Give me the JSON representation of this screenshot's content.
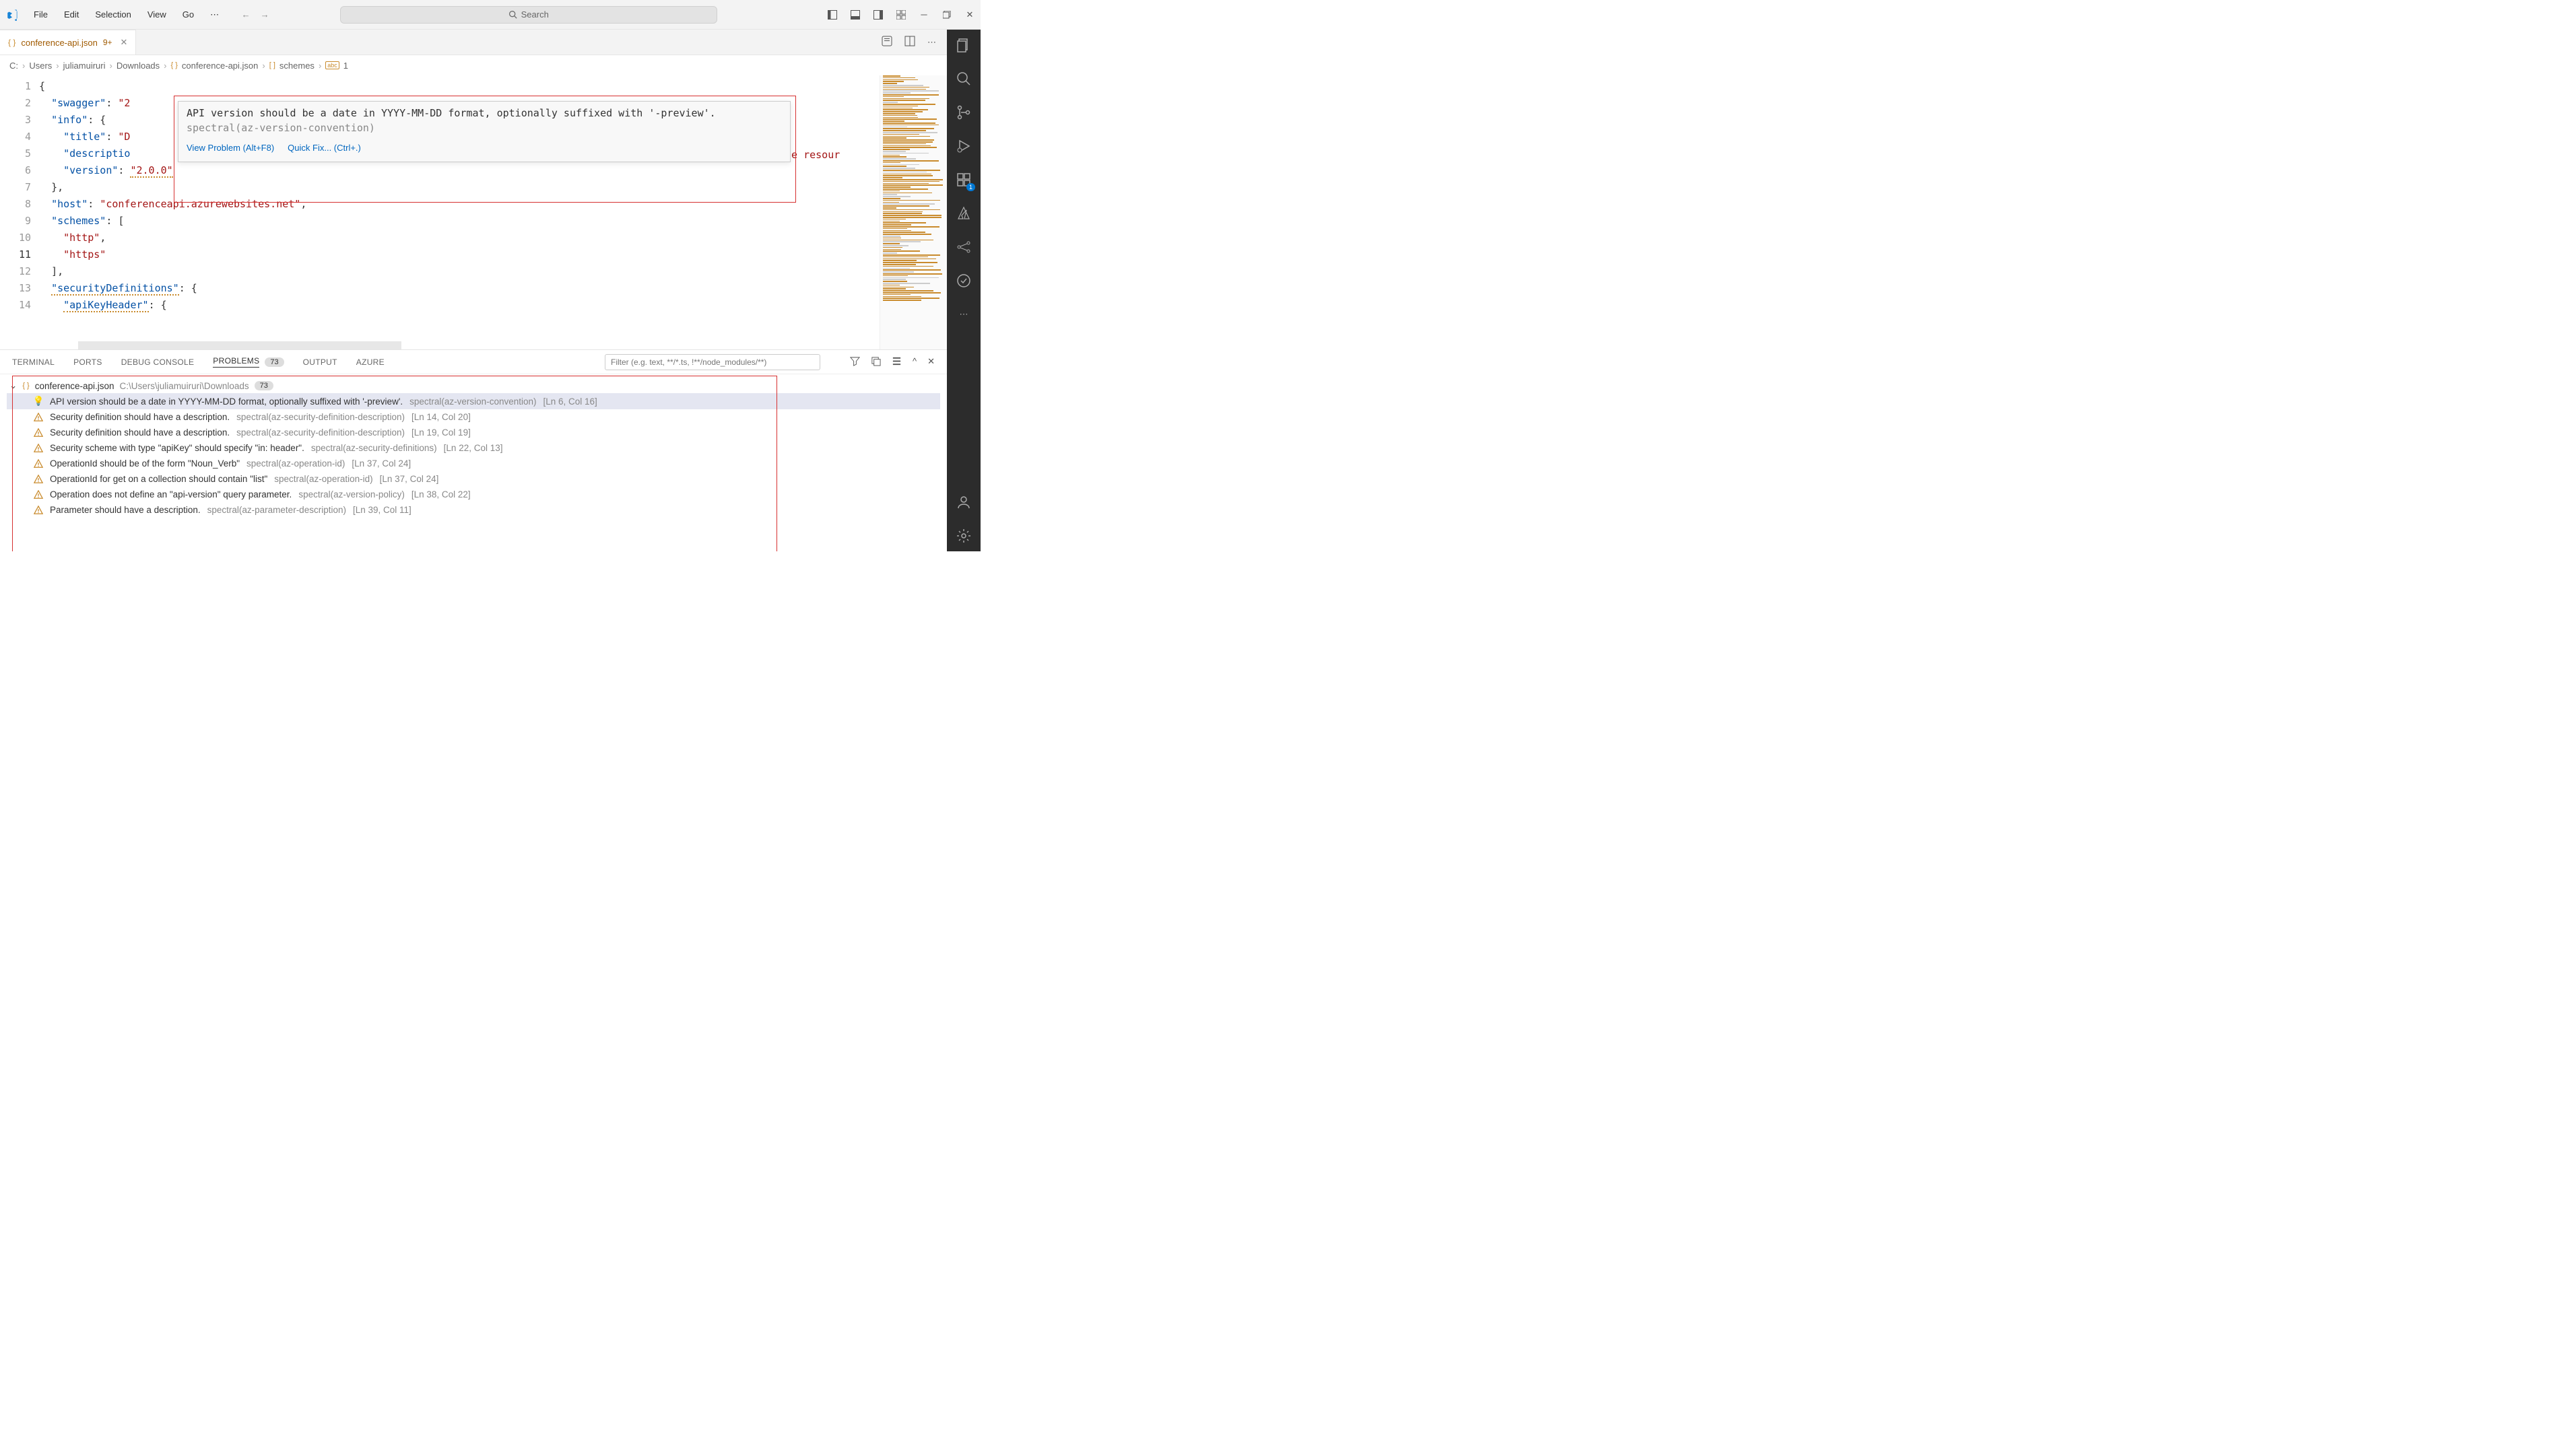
{
  "titlebar": {
    "menu": [
      "File",
      "Edit",
      "Selection",
      "View",
      "Go"
    ],
    "search_placeholder": "Search",
    "nav": {
      "back": "←",
      "fwd": "→"
    }
  },
  "tab": {
    "name": "conference-api.json",
    "badge": "9+"
  },
  "breadcrumb": {
    "parts": [
      "C:",
      "Users",
      "juliamuiruri",
      "Downloads",
      "conference-api.json",
      "schemes",
      "1"
    ]
  },
  "editor": {
    "lines": [
      {
        "num": 1,
        "ind": 0,
        "tokens": [
          [
            "p",
            "{"
          ]
        ]
      },
      {
        "num": 2,
        "ind": 1,
        "tokens": [
          [
            "k",
            "\"swagger\""
          ],
          [
            "p",
            ": "
          ],
          [
            "s",
            "\"2"
          ]
        ]
      },
      {
        "num": 3,
        "ind": 1,
        "tokens": [
          [
            "k",
            "\"info\""
          ],
          [
            "p",
            ": {"
          ]
        ]
      },
      {
        "num": 4,
        "ind": 2,
        "tokens": [
          [
            "k",
            "\"title\""
          ],
          [
            "p",
            ": "
          ],
          [
            "s",
            "\"D"
          ]
        ]
      },
      {
        "num": 5,
        "ind": 2,
        "tokens": [
          [
            "k",
            "\"descriptio"
          ]
        ]
      },
      {
        "num": 6,
        "ind": 2,
        "tokens": [
          [
            "k",
            "\"version\""
          ],
          [
            "p",
            ": "
          ],
          [
            "s",
            "\"2.0.0\""
          ]
        ],
        "version_err": true
      },
      {
        "num": 7,
        "ind": 1,
        "tokens": [
          [
            "p",
            "},"
          ]
        ]
      },
      {
        "num": 8,
        "ind": 1,
        "tokens": [
          [
            "k",
            "\"host\""
          ],
          [
            "p",
            ": "
          ],
          [
            "s",
            "\"conferenceapi.azurewebsites.net\""
          ],
          [
            "p",
            ","
          ]
        ]
      },
      {
        "num": 9,
        "ind": 1,
        "tokens": [
          [
            "k",
            "\"schemes\""
          ],
          [
            "p",
            ": ["
          ]
        ]
      },
      {
        "num": 10,
        "ind": 2,
        "tokens": [
          [
            "s",
            "\"http\""
          ],
          [
            "p",
            ","
          ]
        ]
      },
      {
        "num": 11,
        "ind": 2,
        "tokens": [
          [
            "s",
            "\"https\""
          ]
        ],
        "active": true
      },
      {
        "num": 12,
        "ind": 1,
        "tokens": [
          [
            "p",
            "],"
          ]
        ]
      },
      {
        "num": 13,
        "ind": 1,
        "tokens": [
          [
            "k",
            "\"securityDefinitions\""
          ],
          [
            "p",
            ": {"
          ]
        ],
        "sq": true
      },
      {
        "num": 14,
        "ind": 2,
        "tokens": [
          [
            "k",
            "\"apiKeyHeader\""
          ],
          [
            "p",
            ": {"
          ]
        ],
        "sq": true
      }
    ],
    "trailing_desc": "le resour"
  },
  "hover": {
    "message": "API version should be a date in YYYY-MM-DD format, optionally suffixed with '-preview'.",
    "source": "spectral(az-version-convention)",
    "action_view": "View Problem (Alt+F8)",
    "action_fix": "Quick Fix... (Ctrl+.)"
  },
  "panel": {
    "tabs": [
      "TERMINAL",
      "PORTS",
      "DEBUG CONSOLE",
      "PROBLEMS",
      "OUTPUT",
      "AZURE"
    ],
    "active_tab": "PROBLEMS",
    "badge": "73",
    "filter_placeholder": "Filter (e.g. text, **/*.ts, !**/node_modules/**)",
    "file": {
      "name": "conference-api.json",
      "path": "C:\\Users\\juliamuiruri\\Downloads",
      "count": "73"
    },
    "problems": [
      {
        "icon": "bulb",
        "msg": "API version should be a date in YYYY-MM-DD format, optionally suffixed with '-preview'.",
        "src": "spectral(az-version-convention)",
        "loc": "[Ln 6, Col 16]",
        "selected": true
      },
      {
        "icon": "warn",
        "msg": "Security definition should have a description.",
        "src": "spectral(az-security-definition-description)",
        "loc": "[Ln 14, Col 20]"
      },
      {
        "icon": "warn",
        "msg": "Security definition should have a description.",
        "src": "spectral(az-security-definition-description)",
        "loc": "[Ln 19, Col 19]"
      },
      {
        "icon": "warn",
        "msg": "Security scheme with type \"apiKey\" should specify \"in: header\".",
        "src": "spectral(az-security-definitions)",
        "loc": "[Ln 22, Col 13]"
      },
      {
        "icon": "warn",
        "msg": "OperationId should be of the form \"Noun_Verb\"",
        "src": "spectral(az-operation-id)",
        "loc": "[Ln 37, Col 24]"
      },
      {
        "icon": "warn",
        "msg": "OperationId for get on a collection should contain \"list\"",
        "src": "spectral(az-operation-id)",
        "loc": "[Ln 37, Col 24]"
      },
      {
        "icon": "warn",
        "msg": "Operation does not define an \"api-version\" query parameter.",
        "src": "spectral(az-version-policy)",
        "loc": "[Ln 38, Col 22]"
      },
      {
        "icon": "warn",
        "msg": "Parameter should have a description.",
        "src": "spectral(az-parameter-description)",
        "loc": "[Ln 39, Col 11]"
      }
    ]
  },
  "activity": {
    "ext_badge": "1"
  }
}
